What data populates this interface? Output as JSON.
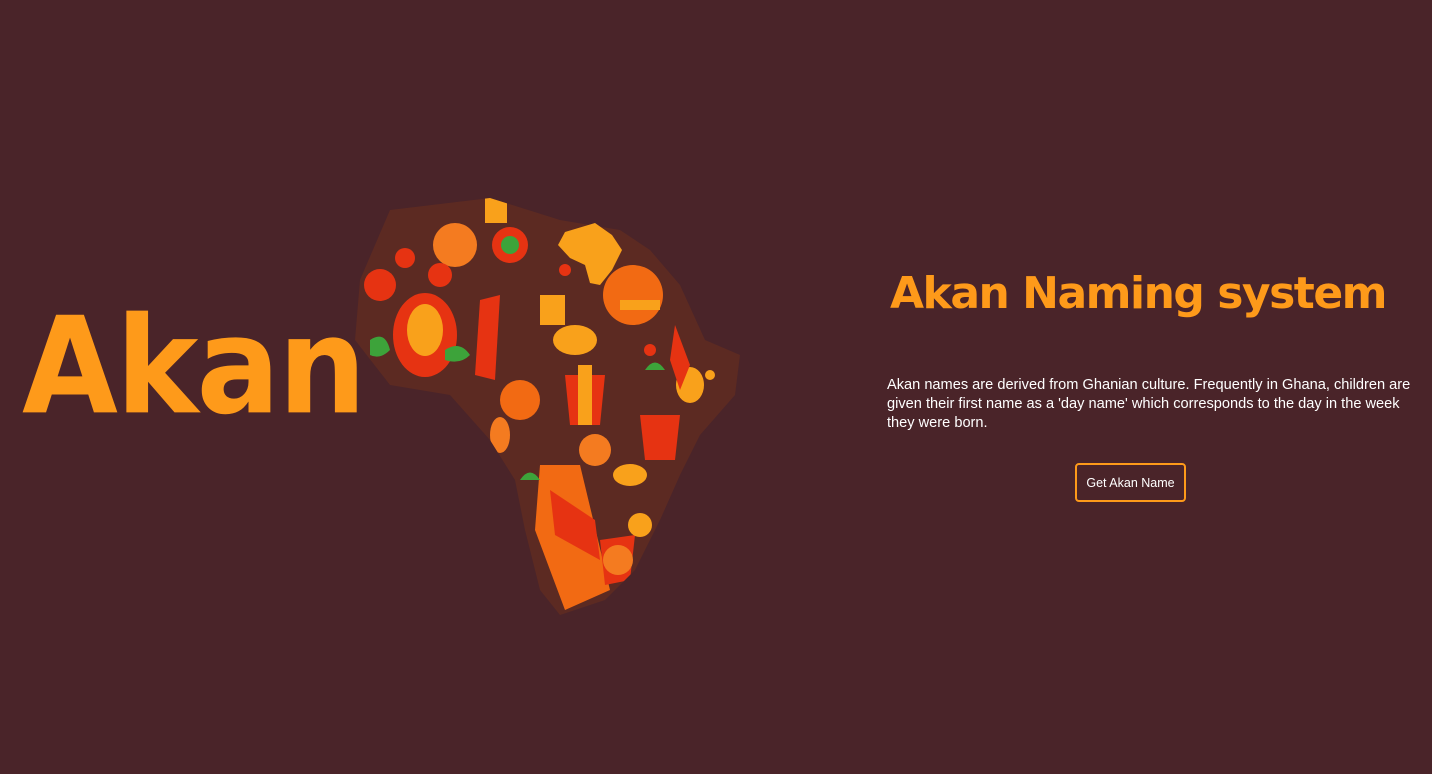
{
  "brand": {
    "logo_text": "Akan"
  },
  "hero": {
    "illustration": "africa-culture-map-illustration",
    "title": "Akan Naming system",
    "description": "Akan names are derived from Ghanian culture. Frequently in Ghana, children are given their first name as a 'day name' which corresponds to the day in the week they were born.",
    "cta_label": "Get Akan Name"
  },
  "colors": {
    "background": "#4a2429",
    "accent": "#fe9a1a",
    "text": "#ffffff"
  }
}
